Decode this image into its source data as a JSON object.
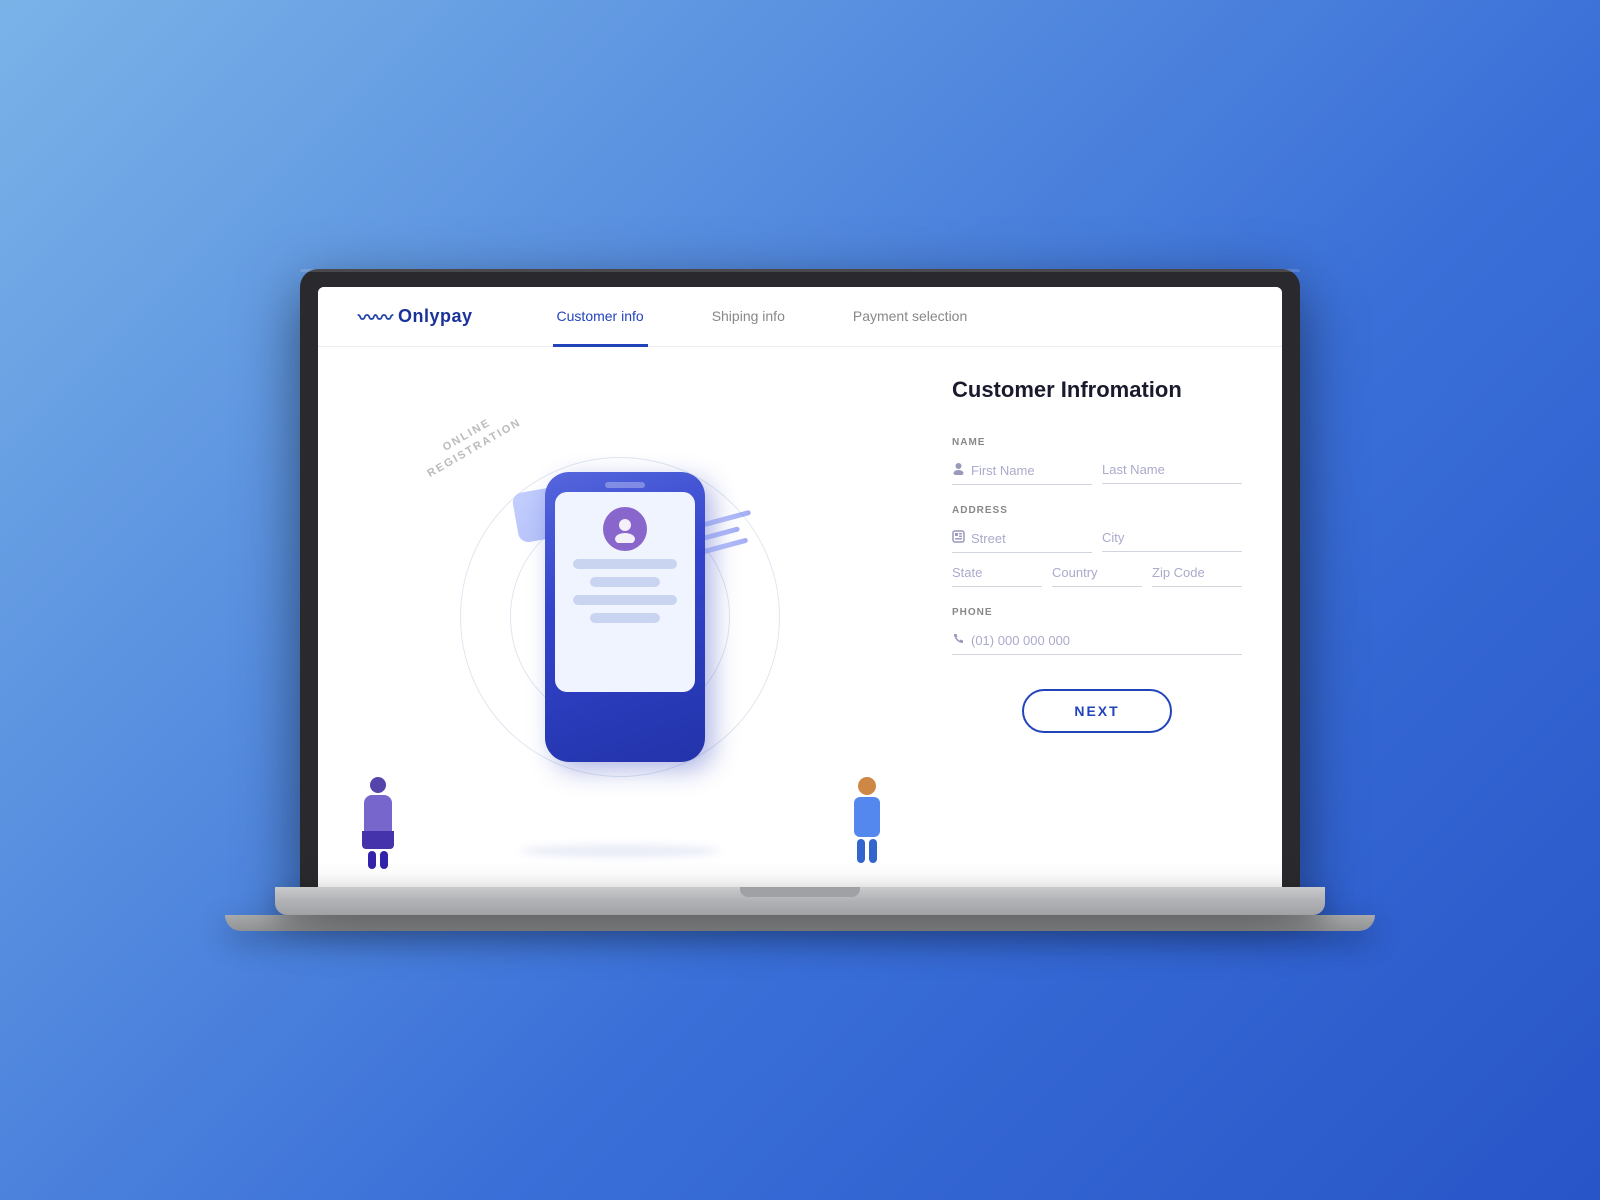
{
  "app": {
    "logo_icon": "〜〜",
    "logo_text": "Onlypay"
  },
  "nav": {
    "tabs": [
      {
        "id": "customer-info",
        "label": "Customer info",
        "active": true
      },
      {
        "id": "shipping-info",
        "label": "Shiping info",
        "active": false
      },
      {
        "id": "payment-selection",
        "label": "Payment selection",
        "active": false
      }
    ]
  },
  "illustration": {
    "arc_line1": "ONLINE",
    "arc_line2": "REGISTRATION"
  },
  "form": {
    "title": "Customer Infromation",
    "sections": {
      "name": {
        "label": "NAME",
        "first_name_placeholder": "First Name",
        "last_name_placeholder": "Last Name"
      },
      "address": {
        "label": "ADDRESS",
        "street_placeholder": "Street",
        "city_placeholder": "City",
        "state_placeholder": "State",
        "country_placeholder": "Country",
        "zip_placeholder": "Zip Code"
      },
      "phone": {
        "label": "PHONE",
        "phone_placeholder": "(01) 000 000 000"
      }
    },
    "next_button_label": "NEXT"
  }
}
